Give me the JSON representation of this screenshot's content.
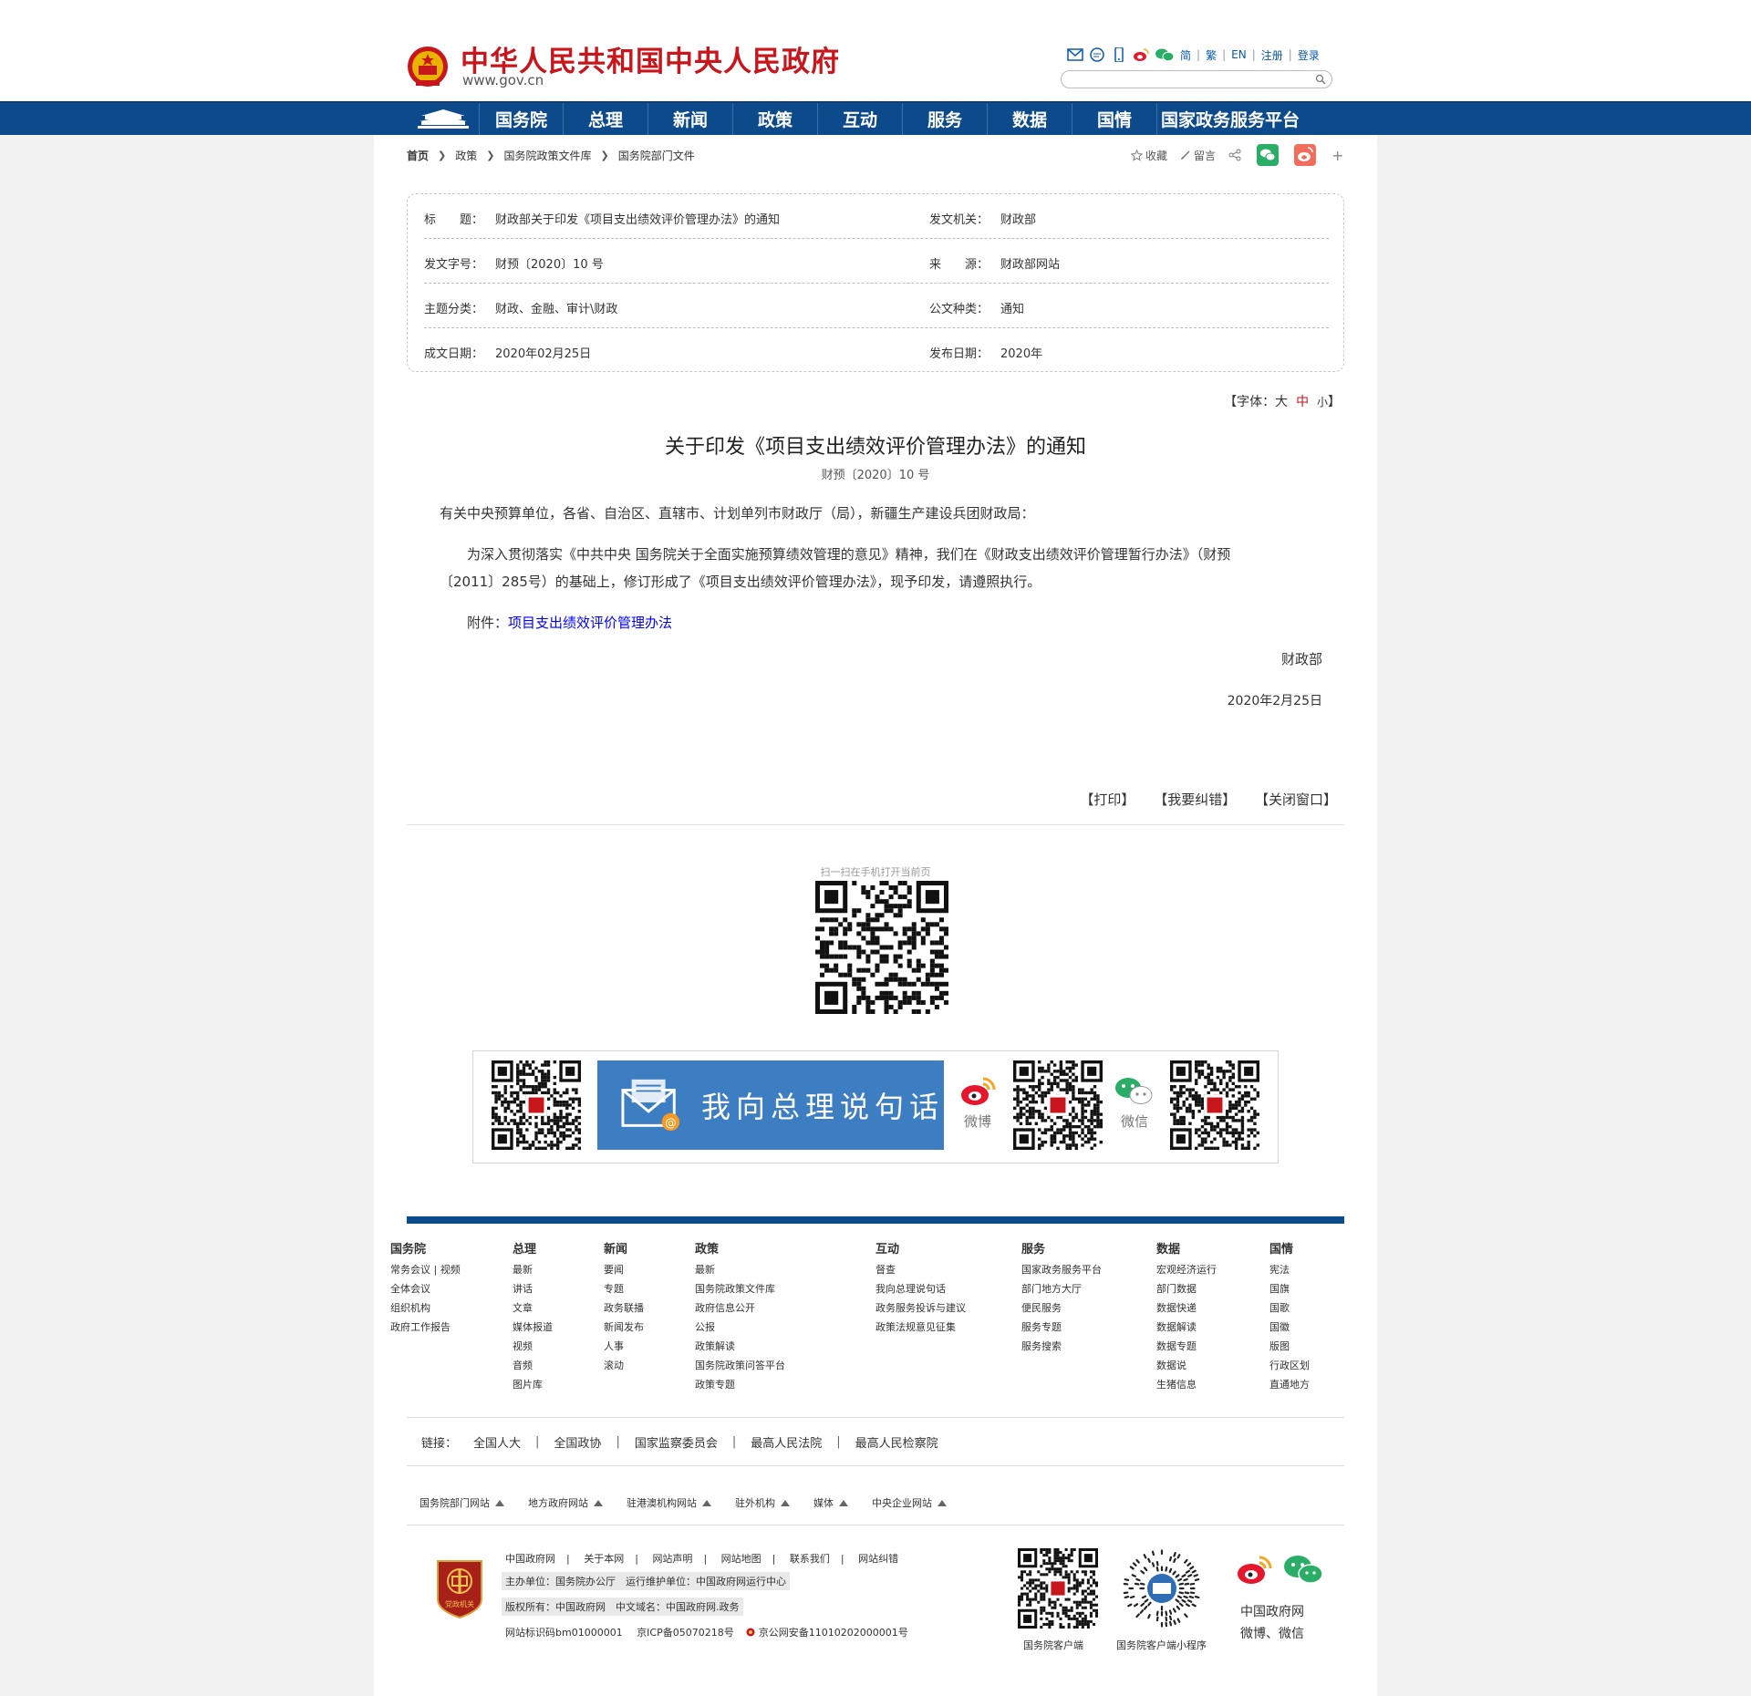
{
  "header": {
    "site_name": "中华人民共和国中央人民政府",
    "site_url": "www.gov.cn",
    "tools": [
      "简",
      "繁",
      "EN",
      "注册",
      "登录"
    ]
  },
  "nav": {
    "items": [
      "国务院",
      "总理",
      "新闻",
      "政策",
      "互动",
      "服务",
      "数据",
      "国情",
      "国家政务服务平台"
    ]
  },
  "breadcrumb": [
    "首页",
    "政策",
    "国务院政策文件库",
    "国务院部门文件"
  ],
  "share": {
    "favorite": "收藏",
    "comment": "留言",
    "plus": "+"
  },
  "meta": {
    "title_label": "标　　题：",
    "title_value": "财政部关于印发《项目支出绩效评价管理办法》的通知",
    "issuer_label": "发文机关：",
    "issuer_value": "财政部",
    "docno_label": "发文字号：",
    "docno_value": "财预〔2020〕10 号",
    "source_label": "来　　源：",
    "source_value": "财政部网站",
    "topic_label": "主题分类：",
    "topic_value": "财政、金融、审计\\财政",
    "type_label": "公文种类：",
    "type_value": "通知",
    "created_label": "成文日期：",
    "created_value": "2020年02月25日",
    "published_label": "发布日期：",
    "published_value": "2020年"
  },
  "fontsize": {
    "prefix": "【字体：",
    "large": "大",
    "medium": "中",
    "small": "小",
    "suffix": "】"
  },
  "article": {
    "title": "关于印发《项目支出绩效评价管理办法》的通知",
    "doc_no": "财预〔2020〕10 号",
    "salutation": "有关中央预算单位，各省、自治区、直辖市、计划单列市财政厅（局），新疆生产建设兵团财政局：",
    "body_line1": "为深入贯彻落实《中共中央 国务院关于全面实施预算绩效管理的意见》精神，我们在《财政支出绩效评价管理暂行办法》（财预",
    "body_line2": "〔2011〕285号）的基础上，修订形成了《项目支出绩效评价管理办法》，现予印发，请遵照执行。",
    "attachment_label": "附件：",
    "attachment_link": "项目支出绩效评价管理办法",
    "signature": "财政部",
    "date": "2020年2月25日"
  },
  "actions": {
    "print": "【打印】",
    "correct": "【我要纠错】",
    "close": "【关闭窗口】"
  },
  "scan_tip": "扫一扫在手机打开当前页",
  "promo": {
    "zongli": "我向总理说句话",
    "weibo": "微博",
    "weixin": "微信"
  },
  "footer_columns": [
    {
      "head": "国务院",
      "items": [
        "常务会议 | 视频",
        "全体会议",
        "组织机构",
        "政府工作报告"
      ]
    },
    {
      "head": "总理",
      "items": [
        "最新",
        "讲话",
        "文章",
        "媒体报道",
        "视频",
        "音频",
        "图片库"
      ]
    },
    {
      "head": "新闻",
      "items": [
        "要闻",
        "专题",
        "政务联播",
        "新闻发布",
        "人事",
        "滚动"
      ]
    },
    {
      "head": "政策",
      "items": [
        "最新",
        "国务院政策文件库",
        "政府信息公开",
        "公报",
        "政策解读",
        "国务院政策问答平台",
        "政策专题"
      ]
    },
    {
      "head": "互动",
      "items": [
        "督查",
        "我向总理说句话",
        "政务服务投诉与建议",
        "政策法规意见征集"
      ]
    },
    {
      "head": "服务",
      "items": [
        "国家政务服务平台",
        "部门地方大厅",
        "便民服务",
        "服务专题",
        "服务搜索"
      ]
    },
    {
      "head": "数据",
      "items": [
        "宏观经济运行",
        "部门数据",
        "数据快递",
        "数据解读",
        "数据专题",
        "数据说",
        "生猪信息"
      ]
    },
    {
      "head": "国情",
      "items": [
        "宪法",
        "国旗",
        "国歌",
        "国徽",
        "版图",
        "行政区划",
        "直通地方"
      ]
    }
  ],
  "links": {
    "label": "链接：",
    "items": [
      "全国人大",
      "全国政协",
      "国家监察委员会",
      "最高人民法院",
      "最高人民检察院"
    ]
  },
  "dropdowns": [
    "国务院部门网站",
    "地方政府网站",
    "驻港澳机构网站",
    "驻外机构",
    "媒体",
    "中央企业网站"
  ],
  "footer": {
    "links": [
      "中国政府网",
      "关于本网",
      "网站声明",
      "网站地图",
      "联系我们",
      "网站纠错"
    ],
    "host": "主办单位：国务院办公厅　运行维护单位：中国政府网运行中心",
    "copyright": "版权所有：中国政府网　中文域名：中国政府网.政务",
    "site_id": "网站标识码bm01000001",
    "icp": "京ICP备05070218号",
    "police": "京公网安备11010202000001号",
    "badge_text": "党政机关",
    "qr1_label": "国务院客户端",
    "qr2_label": "国务院客户端小程序",
    "social_line1": "中国政府网",
    "social_line2": "微博、微信"
  },
  "colors": {
    "brand_red": "#c8161d",
    "nav_blue": "#0c4a8c",
    "link_blue": "#0000ff",
    "promo_blue": "#3d7ec2"
  }
}
